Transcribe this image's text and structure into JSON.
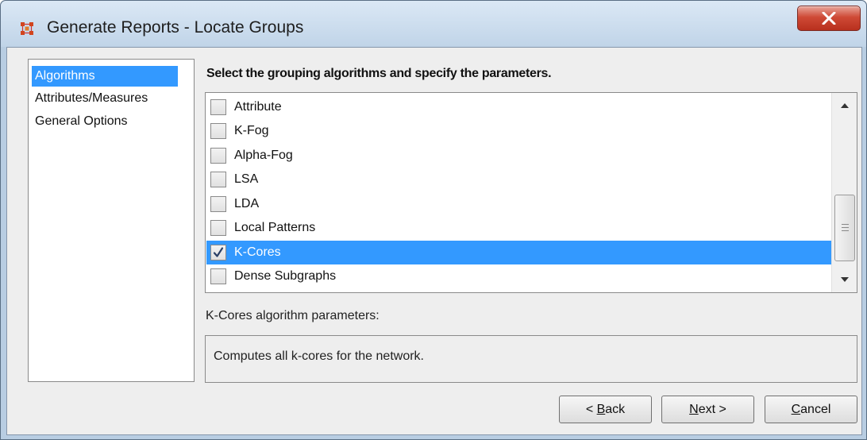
{
  "window": {
    "title": "Generate Reports - Locate Groups"
  },
  "sidebar": {
    "items": [
      {
        "label": "Algorithms",
        "selected": true
      },
      {
        "label": "Attributes/Measures",
        "selected": false
      },
      {
        "label": "General Options",
        "selected": false
      }
    ]
  },
  "main": {
    "instruction": "Select the grouping algorithms and specify the parameters.",
    "algorithms": [
      {
        "label": "Attribute",
        "checked": false,
        "selected": false
      },
      {
        "label": "K-Fog",
        "checked": false,
        "selected": false
      },
      {
        "label": "Alpha-Fog",
        "checked": false,
        "selected": false
      },
      {
        "label": "LSA",
        "checked": false,
        "selected": false
      },
      {
        "label": "LDA",
        "checked": false,
        "selected": false
      },
      {
        "label": "Local Patterns",
        "checked": false,
        "selected": false
      },
      {
        "label": "K-Cores",
        "checked": true,
        "selected": true
      },
      {
        "label": "Dense Subgraphs",
        "checked": false,
        "selected": false
      }
    ],
    "params_label": "K-Cores algorithm parameters:",
    "params_description": "Computes all k-cores for the network."
  },
  "buttons": {
    "back": {
      "prefix": "< ",
      "mnemonic": "B",
      "rest": "ack"
    },
    "next": {
      "prefix": "",
      "mnemonic": "N",
      "rest": "ext >"
    },
    "cancel": {
      "prefix": "",
      "mnemonic": "C",
      "rest": "ancel"
    }
  },
  "colors": {
    "selection": "#3399ff",
    "close_button": "#c7432f",
    "app_icon": "#d2451e"
  },
  "icons": {
    "app": "network-app-icon",
    "close": "close-icon",
    "check": "checkmark-icon",
    "scroll_up": "scroll-up-arrow-icon",
    "scroll_down": "scroll-down-arrow-icon"
  }
}
